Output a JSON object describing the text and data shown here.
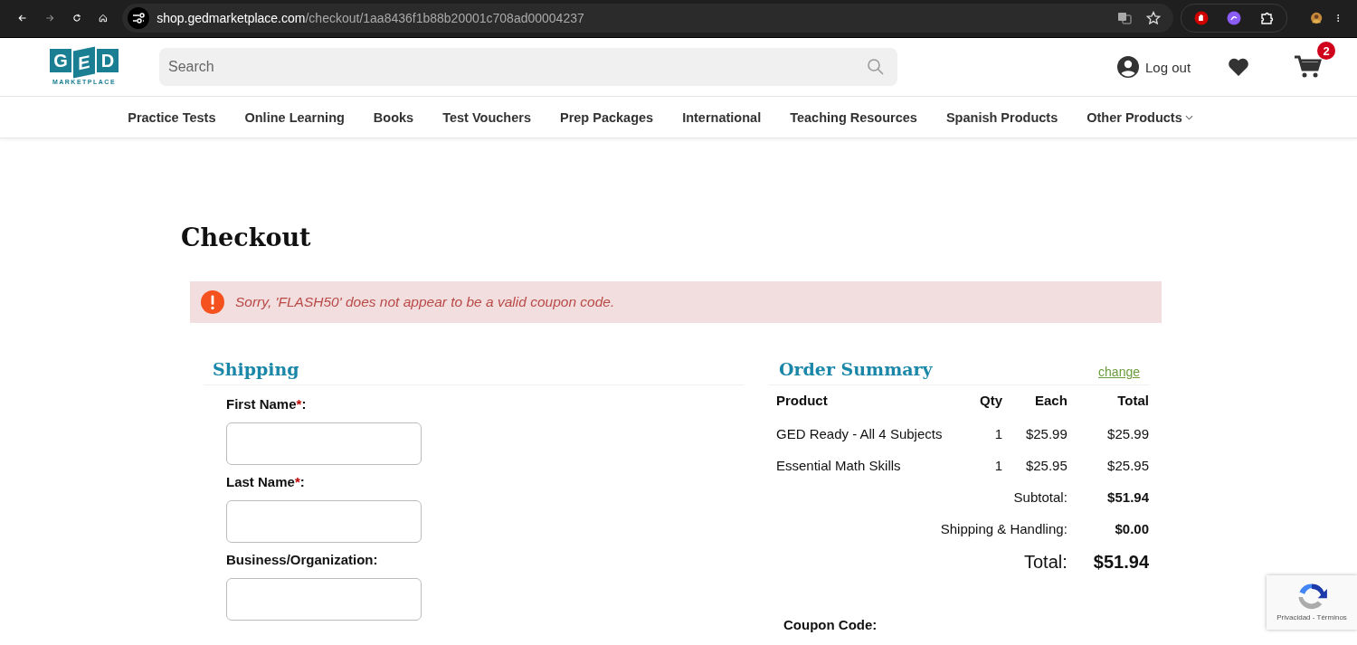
{
  "browser": {
    "url_host": "shop.gedmarketplace.com",
    "url_path": "/checkout/1aa8436f1b88b20001c708ad00004237"
  },
  "header": {
    "logo": {
      "letters": [
        "G",
        "E",
        "D"
      ],
      "tagline": "MARKETPLACE"
    },
    "search": {
      "placeholder": "Search"
    },
    "account_link": "Log out",
    "cart_count": "2"
  },
  "nav": [
    {
      "label": "Practice Tests",
      "dropdown": false
    },
    {
      "label": "Online Learning",
      "dropdown": false
    },
    {
      "label": "Books",
      "dropdown": false
    },
    {
      "label": "Test Vouchers",
      "dropdown": false
    },
    {
      "label": "Prep Packages",
      "dropdown": false
    },
    {
      "label": "International",
      "dropdown": false
    },
    {
      "label": "Teaching Resources",
      "dropdown": false
    },
    {
      "label": "Spanish Products",
      "dropdown": false
    },
    {
      "label": "Other Products",
      "dropdown": true
    }
  ],
  "page_title": "Checkout",
  "alert": {
    "message": "Sorry, 'FLASH50' does not appear to be a valid coupon code."
  },
  "shipping": {
    "title": "Shipping",
    "fields": [
      {
        "label": "First Name",
        "required_mark": "*",
        "suffix": ":"
      },
      {
        "label": "Last Name",
        "required_mark": "*",
        "suffix": ":"
      },
      {
        "label": "Business/Organization",
        "suffix": ":"
      }
    ]
  },
  "order_summary": {
    "title": "Order Summary",
    "change_link": "change",
    "columns": [
      "Product",
      "Qty",
      "Each",
      "Total"
    ],
    "rows": [
      {
        "product": "GED Ready - All 4 Subjects",
        "qty": "1",
        "each": "$25.99",
        "total": "$25.99"
      },
      {
        "product": "Essential Math Skills",
        "qty": "1",
        "each": "$25.95",
        "total": "$25.95"
      }
    ],
    "totals": [
      {
        "label": "Subtotal:",
        "value": "$51.94"
      },
      {
        "label": "Shipping & Handling:",
        "value": "$0.00"
      }
    ],
    "grand_total": {
      "label": "Total:",
      "value": "$51.94"
    },
    "coupon_label": "Coupon Code:"
  },
  "recaptcha": {
    "links": "Privacidad - Términos"
  }
}
